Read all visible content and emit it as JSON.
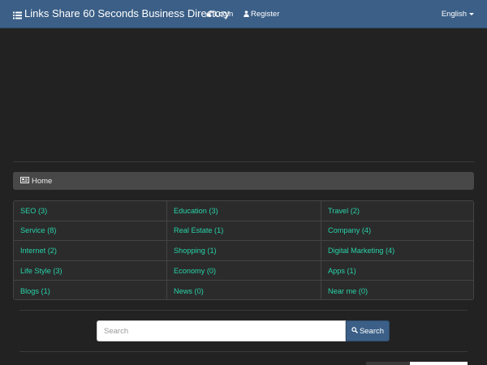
{
  "header": {
    "brand": "Links Share 60 Seconds Business Directory",
    "brand_icon": "list-icon",
    "login_label": "Login",
    "login_icon": "unlock-icon",
    "register_label": "Register",
    "register_icon": "user-icon",
    "language_label": "English"
  },
  "breadcrumb": {
    "icon": "newspaper-icon",
    "label": "Home"
  },
  "categories": [
    [
      "SEO (3)",
      "Education (3)",
      "Travel (2)"
    ],
    [
      "Service (8)",
      "Real Estate (1)",
      "Company (4)"
    ],
    [
      "Internet (2)",
      "Shopping (1)",
      "Digital Marketing (4)"
    ],
    [
      "Life Style (3)",
      "Economy (0)",
      "Apps (1)"
    ],
    [
      "Blogs (1)",
      "News (0)",
      "Near me (0)"
    ]
  ],
  "search": {
    "placeholder": "Search",
    "value": "",
    "button_label": "Search",
    "button_icon": "search-icon"
  },
  "colors": {
    "navbar": "#3b5f87",
    "background": "#222222",
    "link": "#27d3a8",
    "panel": "#484848"
  }
}
